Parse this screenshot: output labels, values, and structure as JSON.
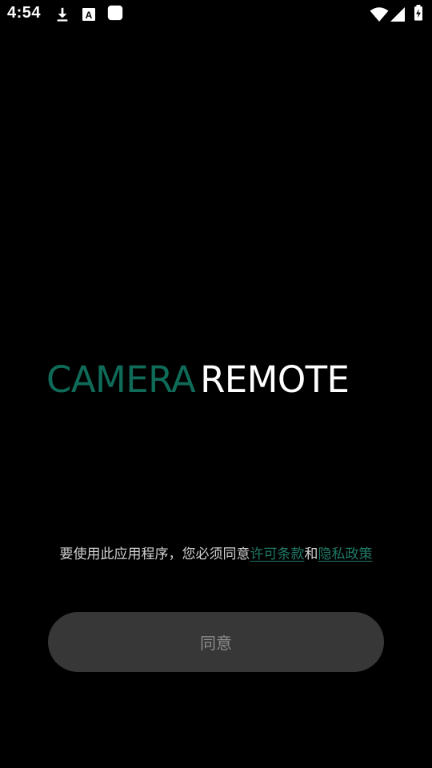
{
  "status_bar": {
    "time": "4:54",
    "left_icons": [
      "download-icon",
      "font-app-icon",
      "app-square-icon"
    ],
    "right_icons": [
      "wifi-icon",
      "signal-icon",
      "battery-charging-icon"
    ]
  },
  "logo": {
    "part1": "CAMERA",
    "part2": "REMOTE",
    "accent_color": "#0f6b58"
  },
  "consent": {
    "prefix": "要使用此应用程序，您必须同意",
    "license_link": "许可条款",
    "conjunction": "和",
    "privacy_link": "隐私政策",
    "link_color": "#1f7a66"
  },
  "agree_button": {
    "label": "同意"
  }
}
